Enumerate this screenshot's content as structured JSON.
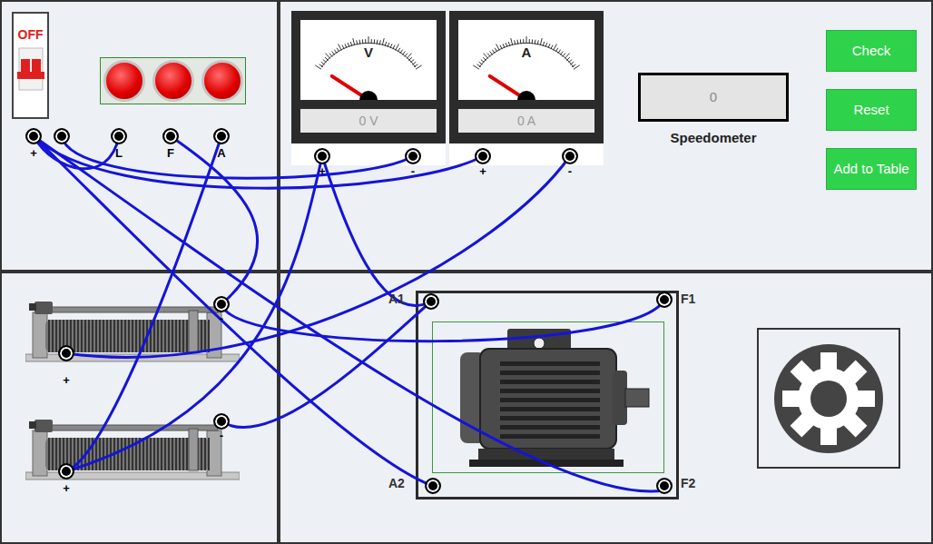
{
  "power_switch": {
    "label": "OFF",
    "on": false
  },
  "supply_terminals": [
    "+",
    "",
    "L",
    "F",
    "A"
  ],
  "indicator_lamps": [
    {
      "lit": true
    },
    {
      "lit": true
    },
    {
      "lit": true
    }
  ],
  "voltmeter": {
    "symbol": "V",
    "reading": "0 V",
    "level": 0,
    "terminals": [
      "+",
      "-"
    ]
  },
  "ammeter": {
    "symbol": "A",
    "reading": "0 A",
    "level": 0,
    "terminals": [
      "+",
      "-"
    ]
  },
  "speedometer": {
    "value": "0",
    "label": "Speedometer"
  },
  "buttons": [
    "Check",
    "Reset",
    "Add to Table"
  ],
  "rheostats": [
    {
      "terminals": [
        "-",
        "+"
      ]
    },
    {
      "terminals": [
        "-",
        "+"
      ]
    }
  ],
  "motor": {
    "terminals": [
      "A1",
      "F1",
      "A2",
      "F2"
    ]
  }
}
